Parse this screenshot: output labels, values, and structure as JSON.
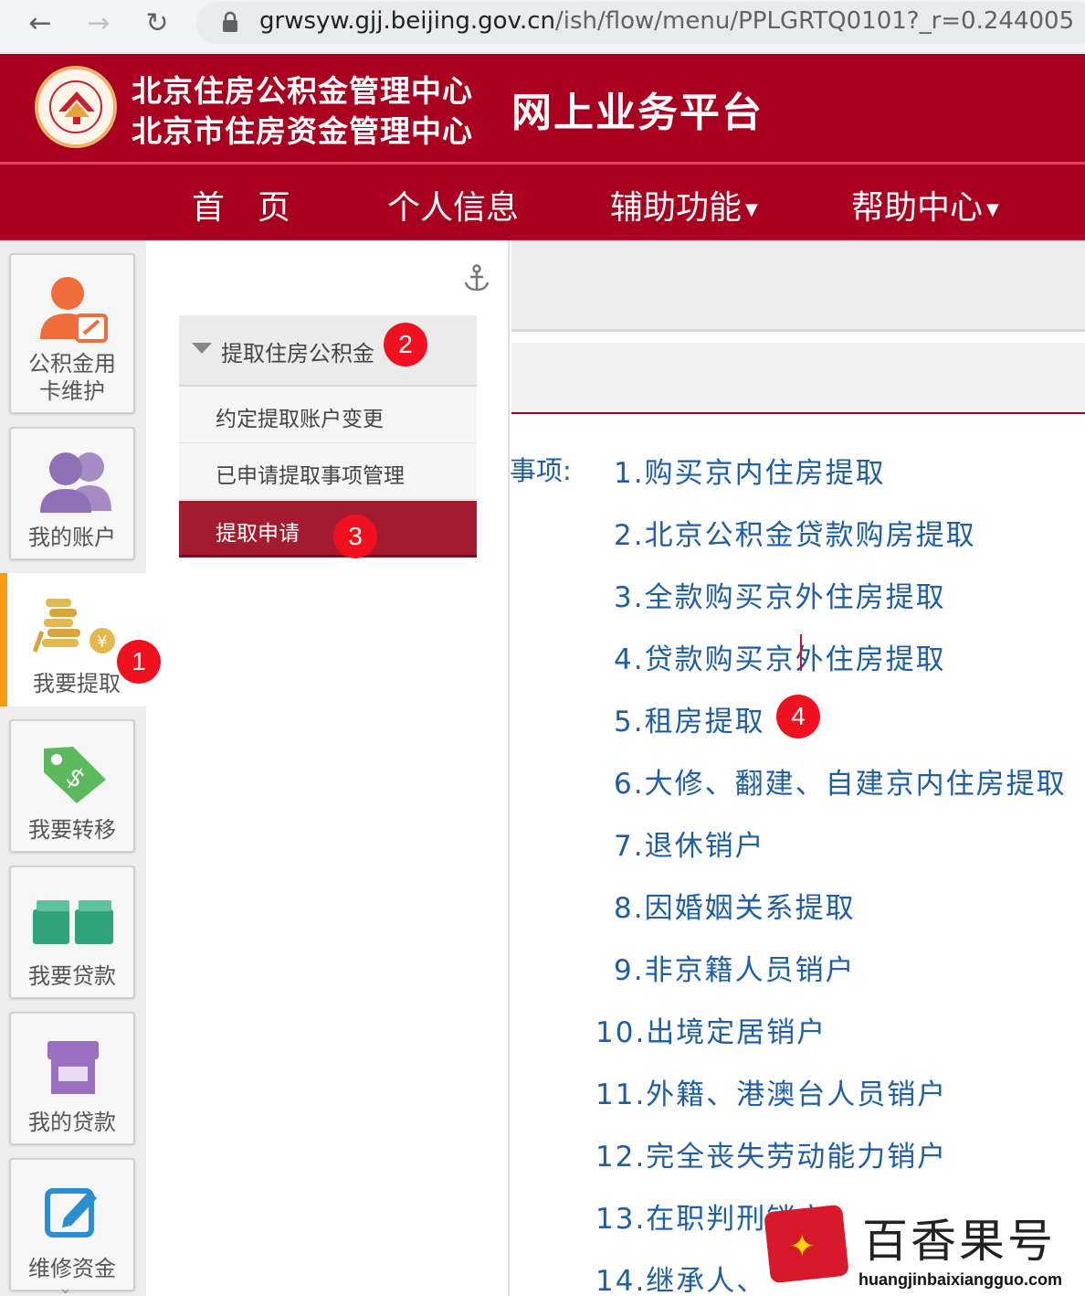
{
  "browser": {
    "url_host": "grwsyw.gjj.beijing.gov.cn",
    "url_path": "/ish/flow/menu/PPLGRTQ0101?_r=0.244005"
  },
  "header": {
    "org_line1": "北京住房公积金管理中心",
    "org_line2": "北京市住房资金管理中心",
    "platform_title": "网上业务平台"
  },
  "nav": {
    "home": "首　页",
    "personal_info": "个人信息",
    "aux_functions": "辅助功能",
    "help_center": "帮助中心"
  },
  "sidebar": {
    "items": [
      {
        "label": "公积金用卡维护",
        "line1": "公积金用",
        "line2": "卡维护",
        "icon": "person-card-icon"
      },
      {
        "label": "我的账户",
        "icon": "users-icon"
      },
      {
        "label": "我要提取",
        "icon": "coins-icon",
        "active": true
      },
      {
        "label": "我要转移",
        "icon": "price-tag-icon"
      },
      {
        "label": "我要贷款",
        "icon": "money-stack-icon"
      },
      {
        "label": "我的贷款",
        "icon": "shop-icon"
      },
      {
        "label": "维修资金",
        "icon": "edit-icon"
      }
    ]
  },
  "menu": {
    "group_label": "提取住房公积金",
    "sub_items": [
      {
        "label": "约定提取账户变更"
      },
      {
        "label": "已申请提取事项管理"
      },
      {
        "label": "提取申请",
        "active": true
      }
    ]
  },
  "content": {
    "section_label": "事项:",
    "items": [
      "1.购买京内住房提取",
      "2.北京公积金贷款购房提取",
      "3.全款购买京外住房提取",
      "4.贷款购买京外住房提取",
      "5.租房提取",
      "6.大修、翻建、自建京内住房提取",
      "7.退休销户",
      "8.因婚姻关系提取",
      "9.非京籍人员销户",
      "10.出境定居销户",
      "11.外籍、港澳台人员销户",
      "12.完全丧失劳动能力销户",
      "13.在职判刑销户",
      "14.继承人、"
    ]
  },
  "badges": [
    "1",
    "2",
    "3",
    "4"
  ],
  "watermark": {
    "title": "百香果号",
    "url": "huangjinbaixiangguo.com"
  },
  "colors": {
    "brand_red": "#a8001e",
    "link_blue": "#1c5ea7",
    "badge_red": "#f0101f",
    "active_accent": "#f39c12"
  }
}
